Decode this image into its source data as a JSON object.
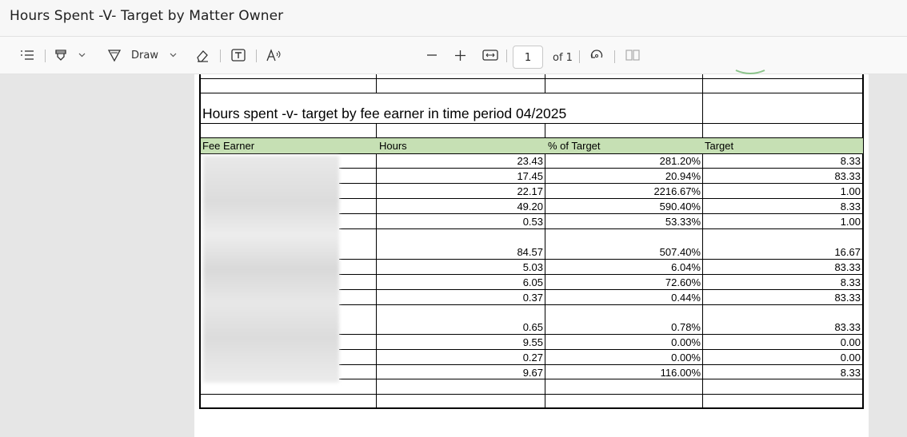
{
  "window": {
    "title": "Hours Spent -V- Target by Matter Owner"
  },
  "toolbar": {
    "draw_label": "Draw",
    "current_page": "1",
    "page_of": "of 1"
  },
  "report": {
    "title": "Hours spent -v- target by fee earner in time period 04/2025",
    "columns": [
      "Fee Earner",
      "Hours",
      "% of Target",
      "Target"
    ],
    "rows": [
      {
        "hours": "23.43",
        "pct": "281.20%",
        "target": "8.33"
      },
      {
        "hours": "17.45",
        "pct": "20.94%",
        "target": "83.33"
      },
      {
        "hours": "22.17",
        "pct": "2216.67%",
        "target": "1.00"
      },
      {
        "hours": "49.20",
        "pct": "590.40%",
        "target": "8.33"
      },
      {
        "hours": "0.53",
        "pct": "53.33%",
        "target": "1.00"
      },
      {
        "hours": "84.57",
        "pct": "507.40%",
        "target": "16.67"
      },
      {
        "hours": "5.03",
        "pct": "6.04%",
        "target": "83.33"
      },
      {
        "hours": "6.05",
        "pct": "72.60%",
        "target": "8.33"
      },
      {
        "hours": "0.37",
        "pct": "0.44%",
        "target": "83.33"
      },
      {
        "hours": "0.65",
        "pct": "0.78%",
        "target": "83.33"
      },
      {
        "hours": "9.55",
        "pct": "0.00%",
        "target": "0.00"
      },
      {
        "hours": "0.27",
        "pct": "0.00%",
        "target": "0.00"
      },
      {
        "hours": "9.67",
        "pct": "116.00%",
        "target": "8.33"
      }
    ]
  },
  "icons": [
    "contents-icon",
    "highlight-icon",
    "chevron-down-icon",
    "draw-icon",
    "eraser-icon",
    "text-box-icon",
    "read-aloud-icon",
    "zoom-out-icon",
    "zoom-in-icon",
    "fit-width-icon",
    "rotate-icon",
    "two-page-icon"
  ]
}
